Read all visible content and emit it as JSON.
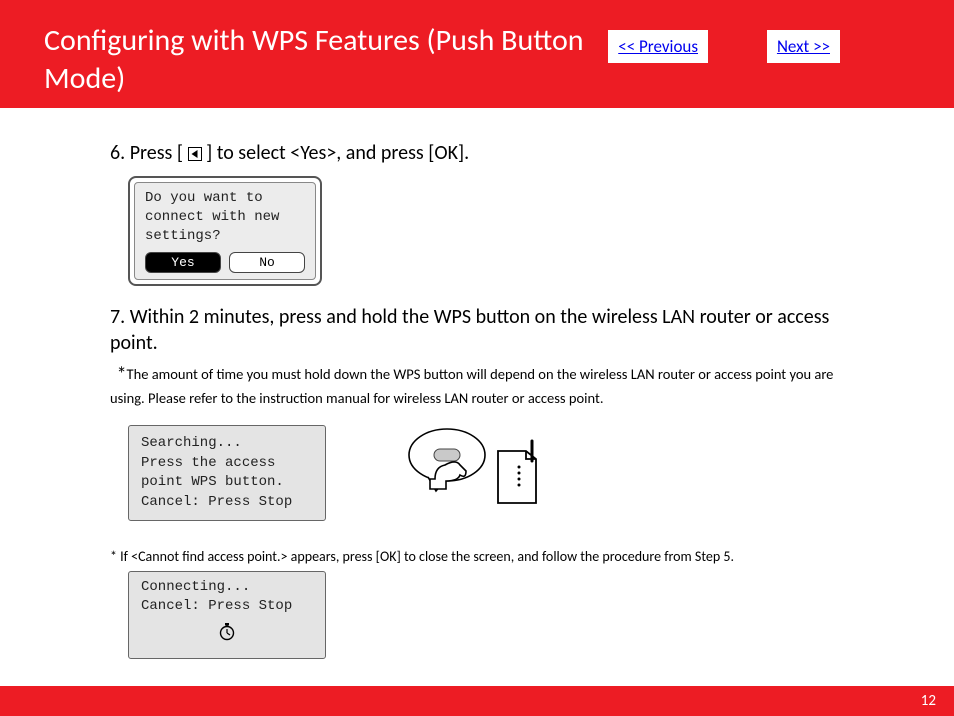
{
  "header": {
    "title": "Configuring with WPS Features (Push Button Mode)",
    "prev": "<< Previous",
    "next": "Next >>"
  },
  "step6": {
    "pre": "6. Press [",
    "post": "] to select <Yes>, and press [OK]."
  },
  "lcd1": {
    "line1": "Do you want to",
    "line2": "connect with new",
    "line3": "settings?",
    "yes": "Yes",
    "no": "No"
  },
  "step7": "7. Within 2 minutes, press and hold the WPS button on the wireless LAN router or access point.",
  "note7": "The amount of time you must hold down the WPS button will depend on the wireless LAN router or access point you are using.  Please refer to the instruction manual for wireless LAN router or access point.",
  "lcd2": {
    "line1": "Searching...",
    "line2": "Press the access",
    "line3": "point WPS button.",
    "line4": "Cancel: Press Stop"
  },
  "note_cannot": "* If <Cannot find access point.> appears, press [OK] to close the screen, and follow the procedure from Step 5.",
  "lcd3": {
    "line1": "Connecting...",
    "line2": "Cancel: Press Stop"
  },
  "pagenum": "12"
}
